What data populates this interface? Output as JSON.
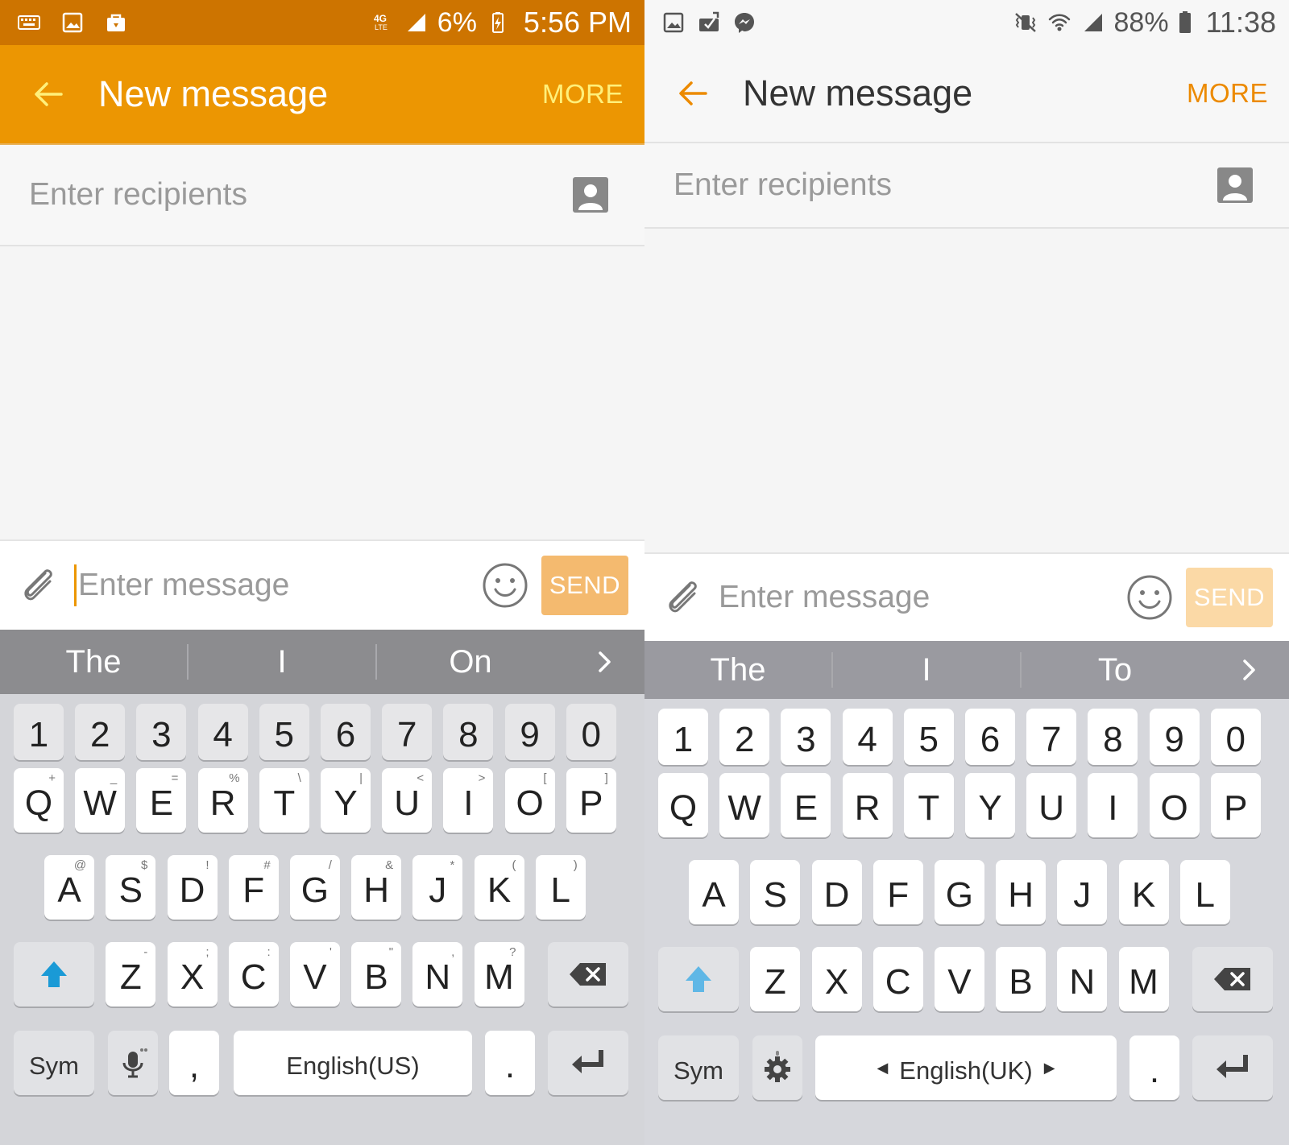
{
  "left": {
    "status": {
      "battery": "6%",
      "time": "5:56 PM",
      "network": "4G"
    },
    "appbar": {
      "title": "New message",
      "more": "MORE"
    },
    "recipients": {
      "placeholder": "Enter recipients"
    },
    "compose": {
      "placeholder": "Enter message",
      "send": "SEND"
    },
    "suggestions": [
      "The",
      "I",
      "On"
    ],
    "keyboard": {
      "numbers": [
        "1",
        "2",
        "3",
        "4",
        "5",
        "6",
        "7",
        "8",
        "9",
        "0"
      ],
      "row1": [
        {
          "k": "Q",
          "s": "+"
        },
        {
          "k": "W",
          "s": "_"
        },
        {
          "k": "E",
          "s": "="
        },
        {
          "k": "R",
          "s": "%"
        },
        {
          "k": "T",
          "s": "\\"
        },
        {
          "k": "Y",
          "s": "|"
        },
        {
          "k": "U",
          "s": "<"
        },
        {
          "k": "I",
          "s": ">"
        },
        {
          "k": "O",
          "s": "["
        },
        {
          "k": "P",
          "s": "]"
        }
      ],
      "row2": [
        {
          "k": "A",
          "s": "@"
        },
        {
          "k": "S",
          "s": "$"
        },
        {
          "k": "D",
          "s": "!"
        },
        {
          "k": "F",
          "s": "#"
        },
        {
          "k": "G",
          "s": "/"
        },
        {
          "k": "H",
          "s": "&"
        },
        {
          "k": "J",
          "s": "*"
        },
        {
          "k": "K",
          "s": "("
        },
        {
          "k": "L",
          "s": ")"
        }
      ],
      "row3": [
        {
          "k": "Z",
          "s": "-"
        },
        {
          "k": "X",
          "s": ";"
        },
        {
          "k": "C",
          "s": ":"
        },
        {
          "k": "V",
          "s": "'"
        },
        {
          "k": "B",
          "s": "\""
        },
        {
          "k": "N",
          "s": ","
        },
        {
          "k": "M",
          "s": "?"
        }
      ],
      "sym": "Sym",
      "comma": ",",
      "space": "English(US)",
      "period": "."
    }
  },
  "right": {
    "status": {
      "battery": "88%",
      "time": "11:38"
    },
    "appbar": {
      "title": "New message",
      "more": "MORE"
    },
    "recipients": {
      "placeholder": "Enter recipients"
    },
    "compose": {
      "placeholder": "Enter message",
      "send": "SEND"
    },
    "suggestions": [
      "The",
      "I",
      "To"
    ],
    "keyboard": {
      "numbers": [
        "1",
        "2",
        "3",
        "4",
        "5",
        "6",
        "7",
        "8",
        "9",
        "0"
      ],
      "row1": [
        {
          "k": "Q"
        },
        {
          "k": "W"
        },
        {
          "k": "E"
        },
        {
          "k": "R"
        },
        {
          "k": "T"
        },
        {
          "k": "Y"
        },
        {
          "k": "U"
        },
        {
          "k": "I"
        },
        {
          "k": "O"
        },
        {
          "k": "P"
        }
      ],
      "row2": [
        {
          "k": "A"
        },
        {
          "k": "S"
        },
        {
          "k": "D"
        },
        {
          "k": "F"
        },
        {
          "k": "G"
        },
        {
          "k": "H"
        },
        {
          "k": "J"
        },
        {
          "k": "K"
        },
        {
          "k": "L"
        }
      ],
      "row3": [
        {
          "k": "Z"
        },
        {
          "k": "X"
        },
        {
          "k": "C"
        },
        {
          "k": "V"
        },
        {
          "k": "B"
        },
        {
          "k": "N"
        },
        {
          "k": "M"
        }
      ],
      "sym": "Sym",
      "space": "English(UK)",
      "period": "."
    }
  },
  "colors": {
    "accent": "#ec9602",
    "status_dark": "#cd7400",
    "shift_blue": "#1a9ad6",
    "shift_light_blue": "#5fb7e6"
  }
}
